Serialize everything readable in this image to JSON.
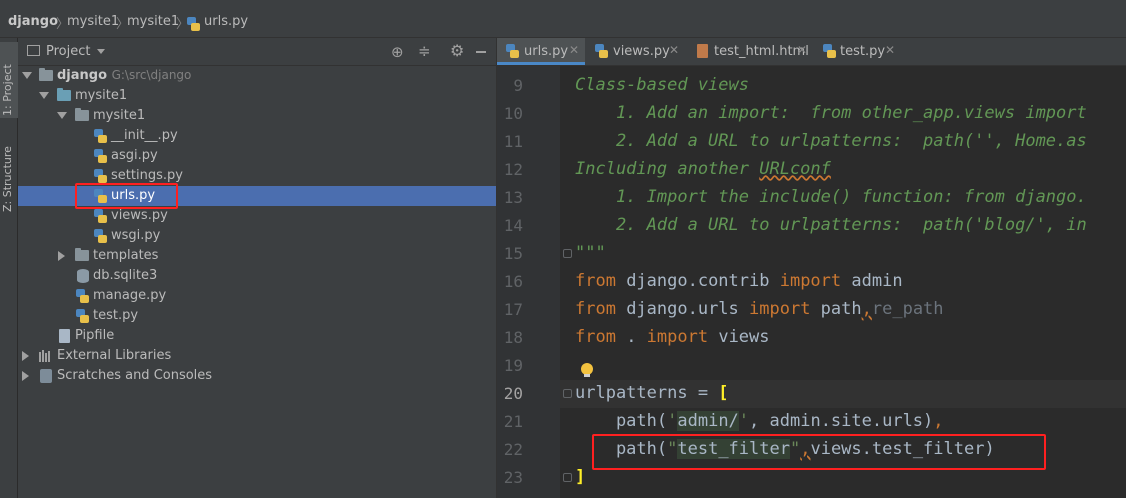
{
  "breadcrumbs": [
    "django",
    "mysite1",
    "mysite1",
    "urls.py"
  ],
  "left_strip": {
    "project_tab": "1: Project",
    "structure_tab": "Z: Structure"
  },
  "project_panel": {
    "title": "Project",
    "root": {
      "name": "django",
      "path": "G:\\src\\django"
    },
    "items": [
      {
        "name": "mysite1"
      },
      {
        "name": "mysite1"
      },
      {
        "name": "__init__.py"
      },
      {
        "name": "asgi.py"
      },
      {
        "name": "settings.py"
      },
      {
        "name": "urls.py",
        "selected": true
      },
      {
        "name": "views.py"
      },
      {
        "name": "wsgi.py"
      },
      {
        "name": "templates"
      },
      {
        "name": "db.sqlite3"
      },
      {
        "name": "manage.py"
      },
      {
        "name": "test.py"
      },
      {
        "name": "Pipfile"
      },
      {
        "name": "External Libraries"
      },
      {
        "name": "Scratches and Consoles"
      }
    ]
  },
  "editor": {
    "tabs": [
      {
        "label": "urls.py",
        "active": true
      },
      {
        "label": "views.py"
      },
      {
        "label": "test_html.html"
      },
      {
        "label": "test.py"
      }
    ],
    "line_numbers": [
      "9",
      "10",
      "11",
      "12",
      "13",
      "14",
      "15",
      "16",
      "17",
      "18",
      "19",
      "20",
      "21",
      "22",
      "23"
    ],
    "current_line": "20",
    "code": {
      "l9": "Class-based views",
      "l10": "    1. Add an import:  from other_app.views import",
      "l11": "    2. Add a URL to urlpatterns:  path('', Home.as",
      "l12_a": "Including another ",
      "l12_b": "URLconf",
      "l13": "    1. Import the include() function: from django.",
      "l14": "    2. Add a URL to urlpatterns:  path('blog/', in",
      "l15": "\"\"\"",
      "l16_kw1": "from",
      "l16_mod": " django.contrib ",
      "l16_kw2": "import",
      "l16_name": " admin",
      "l17_kw1": "from",
      "l17_mod": " django.urls ",
      "l17_kw2": "import",
      "l17_name": " path",
      "l17_comma": ",",
      "l17_dim": "re_path",
      "l18_kw1": "from",
      "l18_mod": " . ",
      "l18_kw2": "import",
      "l18_name": " views",
      "l20_a": "urlpatterns = ",
      "l20_b": "[",
      "l21_a": "    path(",
      "l21_q1": "'",
      "l21_s": "admin/",
      "l21_q2": "'",
      "l21_b": ", admin.site.urls)",
      "l21_c": ",",
      "l22_a": "    path(",
      "l22_q1": "\"",
      "l22_s": "test_filter",
      "l22_q2": "\"",
      "l22_c": ",",
      "l22_b": "views.test_filter)",
      "l23": "]"
    }
  }
}
